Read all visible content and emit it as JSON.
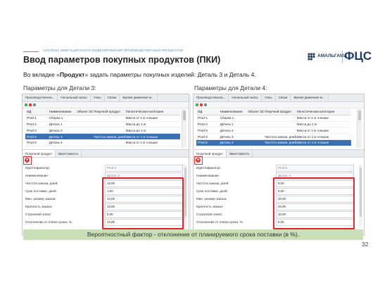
{
  "header": {
    "subtitle": "СИСТЕМА ИМИТАЦИОННОГО МОДЕЛИРОВАНИЯ ПРОИЗВОДСТВЕННЫХ ПРОЦЕССОВ",
    "title": "Ввод параметров покупных продуктов (ПКИ)"
  },
  "logo": {
    "brand": "АМАЛЬГАМА",
    "product": "ФЦС",
    "icon": "amalgama-logo-icon"
  },
  "intro": {
    "prefix": "Во вкладке «",
    "tab": "Продукт",
    "suffix": "» задать параметры покупных изделий: Деталь 3 и Деталь 4."
  },
  "left_label": "Параметры для Детали 3:",
  "right_label": "Параметры для Детали 4:",
  "app": {
    "tabs": [
      "Производственна...",
      "Начальный запас",
      "Узлы",
      "Связи",
      "Время движения м..."
    ],
    "columns": [
      "ИД",
      "Наименование",
      "Объект 3d",
      "Покупной продукт",
      "Логистическая категория"
    ],
    "rows_left": [
      [
        "Prod-1",
        "Сборка 1",
        "",
        "",
        "Масса от 1 кг и выше"
      ],
      [
        "Prod-2",
        "Деталь 1",
        "",
        "",
        "Масса до 1 кг"
      ],
      [
        "Prod-3",
        "Деталь 2",
        "",
        "",
        "Масса до 1 кг"
      ],
      [
        "Prod-4",
        "Деталь 3",
        "",
        "Частота заказа, дней: ...",
        "Масса от 1 кг и выше"
      ],
      [
        "Prod-5",
        "Деталь 4",
        "",
        "",
        "Масса от 1 кг и выше"
      ]
    ],
    "rows_right": [
      [
        "Prod-1",
        "Сборка 1",
        "",
        "",
        "Масса от 1 кг и выше"
      ],
      [
        "Prod-2",
        "Деталь 1",
        "",
        "",
        "Масса до 1 кг"
      ],
      [
        "Prod-3",
        "Деталь 2",
        "",
        "",
        "Масса от 1 кг и выше"
      ],
      [
        "Prod-4",
        "Деталь 3",
        "",
        "Частота заказа, дней...",
        "Масса от 1 кг и выше"
      ],
      [
        "Prod-5",
        "Деталь 4",
        "",
        "Частота заказа, дней...",
        "Масса от 1 кг и выше"
      ]
    ],
    "pane_tabs": [
      "Покупной продукт",
      "Вместимость"
    ],
    "field_labels": [
      "Идентификатор:",
      "Наименование:",
      "Частота заказа, дней:",
      "Срок поставки, дней:",
      "Мин. размер заказа:",
      "Кратность заказа:",
      "Страховой запас:",
      "Отклонение от плана срока, %:"
    ],
    "values_left": [
      "Prod-4",
      "Деталь 3",
      "10,00",
      "1,00",
      "10,00",
      "10,00",
      "5,00",
      "10,00"
    ],
    "values_right": [
      "Prod-5",
      "Деталь 4",
      "5,00",
      "5,00",
      "20,00",
      "20,00",
      "10,00",
      "5,00"
    ]
  },
  "note": "Вероятностный фактор - отклонение от планируемого срока поставки (в %).",
  "page_number": "32",
  "colors": {
    "accent_red": "#e0252c",
    "note_bg": "#c9dfb7",
    "selection": "#3a6fb0"
  }
}
